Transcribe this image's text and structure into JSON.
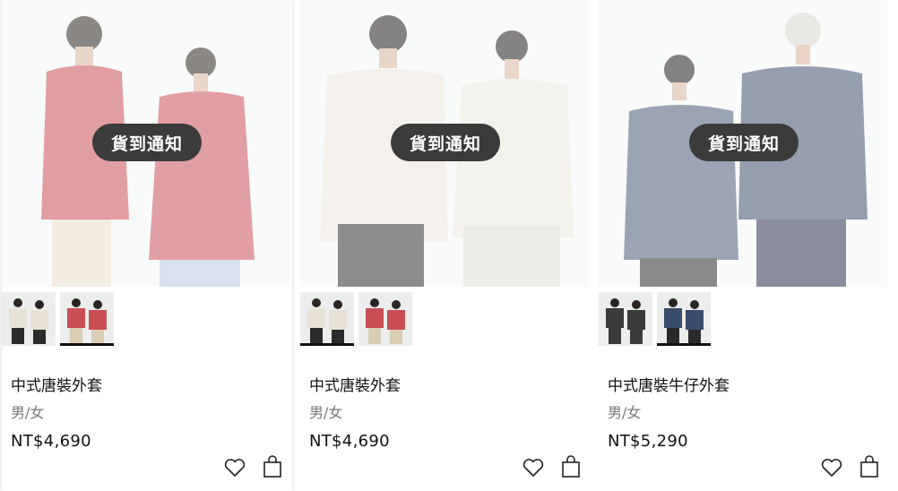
{
  "products": [
    {
      "name": "中式唐裝外套",
      "gender": "男/女",
      "price": "NT$4,690",
      "notify_label": "貨到通知",
      "colors": {
        "hero_jacket_left": "#c94f55",
        "hero_jacket_right": "#c9505a",
        "hero_pants_left": "#e8dcc8",
        "hero_pants_right": "#b7cbe0"
      },
      "swatches": [
        {
          "name": "cream",
          "jacket": "#e8e2d6",
          "pants": "#2b2b2b",
          "active": false
        },
        {
          "name": "red",
          "jacket": "#c94f55",
          "pants": "#d9cdb6",
          "active": true
        }
      ]
    },
    {
      "name": "中式唐裝外套",
      "gender": "男/女",
      "price": "NT$4,690",
      "notify_label": "貨到通知",
      "colors": {
        "hero_jacket_left": "#ebe6dd",
        "hero_jacket_right": "#ece7de",
        "hero_pants_left": "#2e2e30",
        "hero_pants_right": "#e0ddd8"
      },
      "swatches": [
        {
          "name": "cream",
          "jacket": "#e8e2d6",
          "pants": "#2b2b2b",
          "active": true
        },
        {
          "name": "red",
          "jacket": "#c94f55",
          "pants": "#d9cdb6",
          "active": false
        }
      ]
    },
    {
      "name": "中式唐裝牛仔外套",
      "gender": "男/女",
      "price": "NT$5,290",
      "notify_label": "貨到通知",
      "colors": {
        "hero_jacket_left": "#4a5a78",
        "hero_jacket_right": "#3f4f6e",
        "hero_pants_left": "#2a2a2c",
        "hero_pants_right": "#2b3050"
      },
      "swatches": [
        {
          "name": "black",
          "jacket": "#3a3a3a",
          "pants": "#3a3a3a",
          "active": false
        },
        {
          "name": "denim",
          "jacket": "#3a4c6c",
          "pants": "#2a2a2c",
          "active": true
        }
      ]
    }
  ]
}
